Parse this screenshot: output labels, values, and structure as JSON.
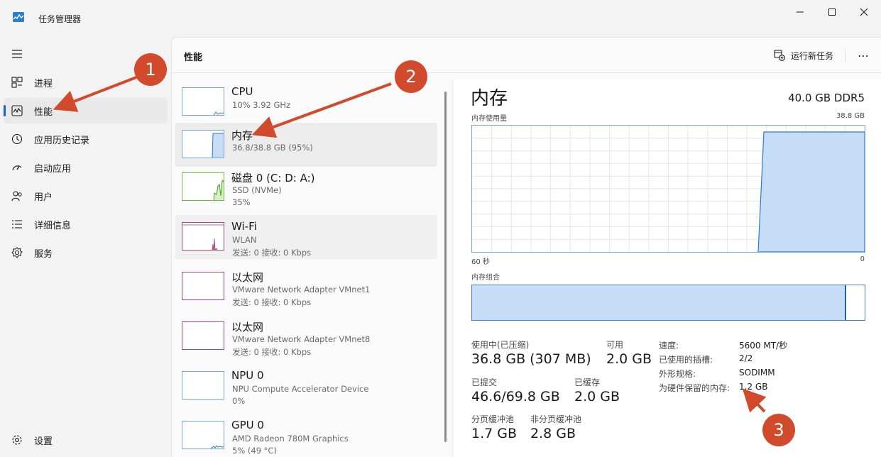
{
  "window": {
    "title": "任务管理器"
  },
  "sidebar": {
    "items": [
      {
        "label": "进程",
        "icon": "processes-icon"
      },
      {
        "label": "性能",
        "icon": "performance-icon"
      },
      {
        "label": "应用历史记录",
        "icon": "history-icon"
      },
      {
        "label": "启动应用",
        "icon": "startup-icon"
      },
      {
        "label": "用户",
        "icon": "users-icon"
      },
      {
        "label": "详细信息",
        "icon": "details-icon"
      },
      {
        "label": "服务",
        "icon": "services-icon"
      }
    ],
    "settings_label": "设置"
  },
  "header": {
    "title": "性能",
    "run_task_label": "运行新任务",
    "more_label": "⋯"
  },
  "devices": [
    {
      "name": "CPU",
      "lines": [
        "10% 3.92 GHz"
      ]
    },
    {
      "name": "内存",
      "lines": [
        "36.8/38.8 GB (95%)"
      ]
    },
    {
      "name": "磁盘 0 (C: D: A:)",
      "lines": [
        "SSD (NVMe)",
        "35%"
      ]
    },
    {
      "name": "Wi-Fi",
      "lines": [
        "WLAN",
        "发送: 0 接收: 0 Kbps"
      ]
    },
    {
      "name": "以太网",
      "lines": [
        "VMware Network Adapter VMnet1",
        "发送: 0 接收: 0 Kbps"
      ]
    },
    {
      "name": "以太网",
      "lines": [
        "VMware Network Adapter VMnet8",
        "发送: 0 接收: 0 Kbps"
      ]
    },
    {
      "name": "NPU 0",
      "lines": [
        "NPU Compute Accelerator Device",
        "0%"
      ]
    },
    {
      "name": "GPU 0",
      "lines": [
        "AMD Radeon 780M Graphics",
        "5% (49 °C)"
      ]
    }
  ],
  "detail": {
    "title": "内存",
    "spec": "40.0 GB DDR5",
    "usage_label": "内存使用量",
    "usage_max": "38.8 GB",
    "time_left": "60 秒",
    "time_right": "0",
    "composition_label": "内存组合",
    "stats": [
      {
        "label": "使用中(已压缩)",
        "value": "36.8 GB (307 MB)"
      },
      {
        "label": "可用",
        "value": "2.0 GB"
      },
      {
        "label": "已提交",
        "value": "46.6/69.8 GB"
      },
      {
        "label": "已缓存",
        "value": "2.0 GB"
      },
      {
        "label": "分页缓冲池",
        "value": "1.7 GB"
      },
      {
        "label": "非分页缓冲池",
        "value": "2.8 GB"
      }
    ],
    "properties": [
      {
        "label": "速度:",
        "value": "5600 MT/秒"
      },
      {
        "label": "已使用的插槽:",
        "value": "2/2"
      },
      {
        "label": "外形规格:",
        "value": "SODIMM"
      },
      {
        "label": "为硬件保留的内存:",
        "value": "1.2 GB"
      }
    ]
  },
  "annotations": [
    {
      "number": "1"
    },
    {
      "number": "2"
    },
    {
      "number": "3"
    }
  ],
  "colors": {
    "accent": "#0f62c7",
    "badge": "#d14a2b",
    "memory_fill": "#c6dcf7",
    "memory_border": "#4e7fbf"
  }
}
